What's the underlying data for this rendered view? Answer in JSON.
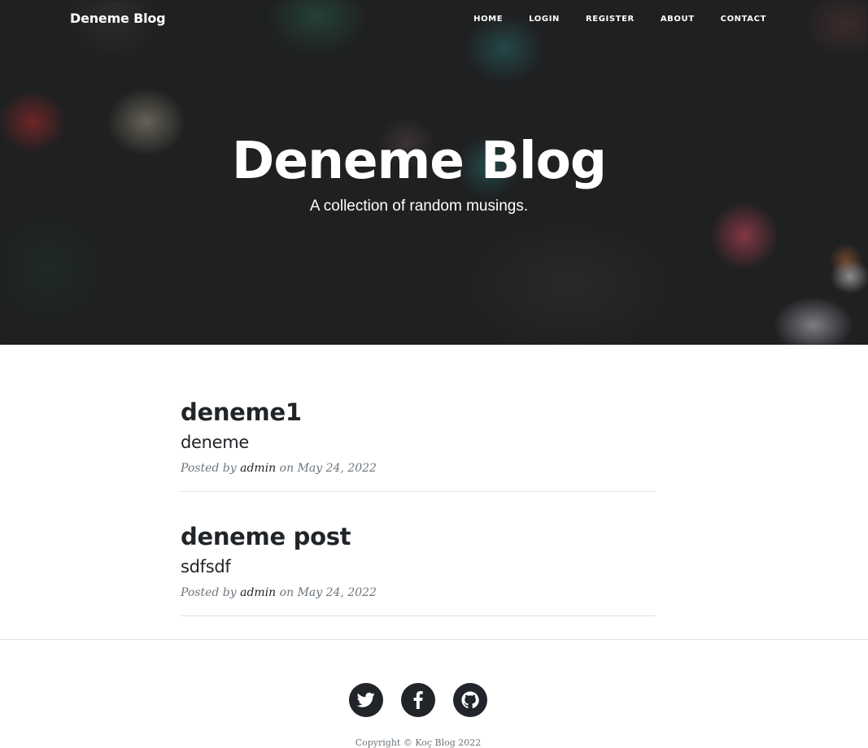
{
  "nav": {
    "brand": "Deneme Blog",
    "links": [
      "HOME",
      "LOGIN",
      "REGISTER",
      "ABOUT",
      "CONTACT"
    ]
  },
  "hero": {
    "title": "Deneme Blog",
    "subtitle": "A collection of random musings."
  },
  "posts": [
    {
      "title": "deneme1",
      "subtitle": "deneme",
      "meta_prefix": "Posted by",
      "author": "admin",
      "meta_on": "on",
      "date": "May 24, 2022"
    },
    {
      "title": "deneme post",
      "subtitle": "sdfsdf",
      "meta_prefix": "Posted by",
      "author": "admin",
      "meta_on": "on",
      "date": "May 24, 2022"
    }
  ],
  "footer": {
    "social_icons": [
      "twitter-icon",
      "facebook-icon",
      "github-icon"
    ],
    "copyright": "Copyright © Koç Blog 2022"
  },
  "colors": {
    "text": "#212529",
    "muted": "#6c757d",
    "divider": "#dee2e6",
    "social_bg": "#212529"
  }
}
